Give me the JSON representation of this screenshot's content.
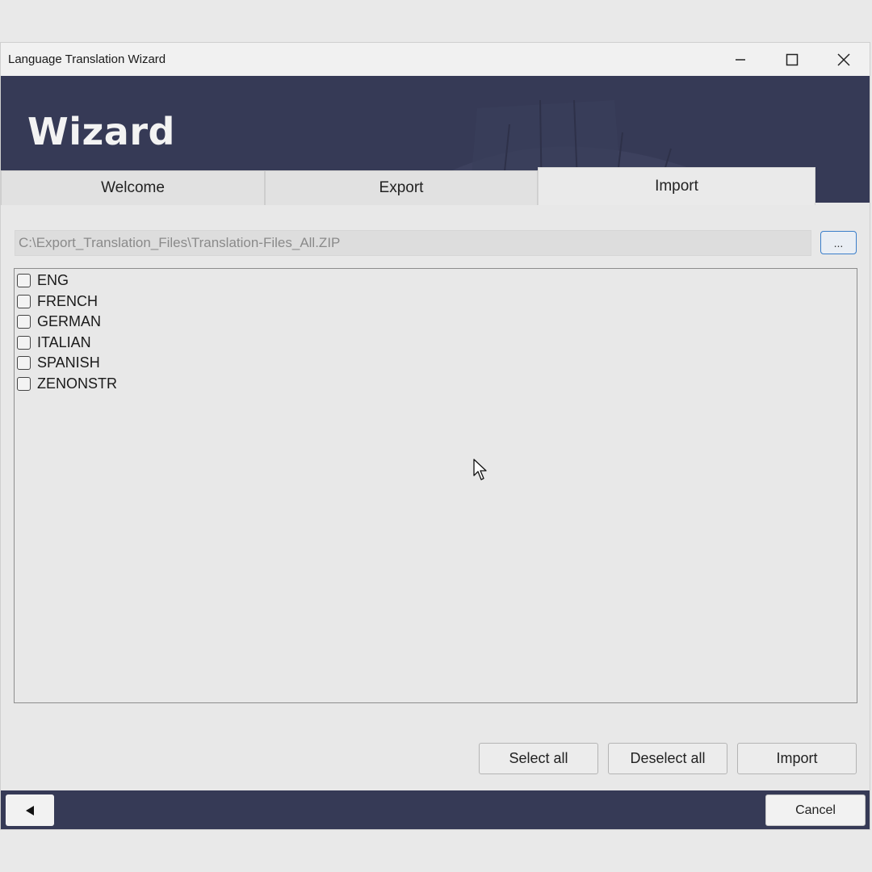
{
  "window": {
    "title": "Language Translation Wizard",
    "controls": [
      "minimize-icon",
      "maximize-icon",
      "close-icon"
    ]
  },
  "header": {
    "title": "Wizard",
    "background_color": "#363a56"
  },
  "tabs": [
    {
      "label": "Welcome",
      "active": false
    },
    {
      "label": "Export",
      "active": false
    },
    {
      "label": "Import",
      "active": true
    }
  ],
  "import": {
    "file_path": "C:\\Export_Translation_Files\\Translation-Files_All.ZIP",
    "browse_label": "...",
    "languages": [
      {
        "label": "ENG",
        "checked": false
      },
      {
        "label": "FRENCH",
        "checked": false
      },
      {
        "label": "GERMAN",
        "checked": false
      },
      {
        "label": "ITALIAN",
        "checked": false
      },
      {
        "label": "SPANISH",
        "checked": false
      },
      {
        "label": "ZENONSTR",
        "checked": false
      }
    ],
    "select_all_label": "Select all",
    "deselect_all_label": "Deselect all",
    "import_label": "Import"
  },
  "footer": {
    "back_icon": "triangle-left-icon",
    "cancel_label": "Cancel"
  },
  "colors": {
    "accent": "#3a7ec9",
    "footer": "#363a56"
  }
}
